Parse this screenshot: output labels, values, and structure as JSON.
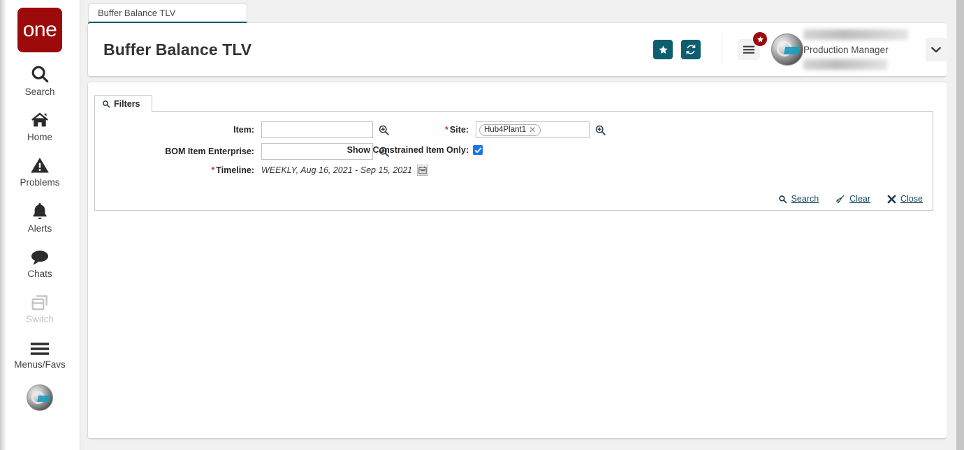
{
  "brand": {
    "logo_text": "one",
    "logo_color": "#9c0a0a",
    "accent_teal": "#0f5e70",
    "accent_blue": "#1a73e8",
    "link_color": "#1b4b66"
  },
  "sidebar": {
    "items": [
      {
        "label": "Search",
        "icon": "search-icon",
        "disabled": false
      },
      {
        "label": "Home",
        "icon": "home-icon",
        "disabled": false
      },
      {
        "label": "Problems",
        "icon": "warning-icon",
        "disabled": false
      },
      {
        "label": "Alerts",
        "icon": "bell-icon",
        "disabled": false
      },
      {
        "label": "Chats",
        "icon": "chat-icon",
        "disabled": false
      },
      {
        "label": "Switch",
        "icon": "switch-icon",
        "disabled": true
      },
      {
        "label": "Menus/Favs",
        "icon": "hamburger-icon",
        "disabled": false
      }
    ],
    "avatar": "user-avatar"
  },
  "tabs": [
    {
      "label": "Buffer Balance TLV",
      "active": true
    }
  ],
  "header": {
    "title": "Buffer Balance TLV",
    "favorite_icon": "star-icon",
    "refresh_icon": "refresh-icon",
    "menu_icon": "hamburger-icon",
    "menu_badge_icon": "star-badge-icon",
    "user_role": "Production Manager",
    "user_caret_icon": "chevron-down-icon"
  },
  "filters": {
    "tab_label": "Filters",
    "tab_icon": "search-icon",
    "fields": {
      "item": {
        "label": "Item:",
        "value": "",
        "placeholder": "",
        "required": false,
        "lookup_icon": "magnifier-plus-icon"
      },
      "bom_item_enterprise": {
        "label": "BOM Item Enterprise:",
        "value": "",
        "placeholder": "",
        "required": false,
        "lookup_icon": "magnifier-plus-icon"
      },
      "timeline": {
        "label": "Timeline:",
        "value": "WEEKLY, Aug 16, 2021 - Sep 15, 2021",
        "required": true,
        "calendar_icon": "calendar-icon"
      },
      "site": {
        "label": "Site:",
        "required": true,
        "chips": [
          {
            "label": "Hub4Plant1",
            "remove_icon": "close-x-icon"
          }
        ],
        "lookup_icon": "magnifier-plus-icon"
      },
      "show_constrained_item_only": {
        "label": "Show Constrained Item Only:",
        "checked": true,
        "checkbox_icon": "check-icon"
      }
    },
    "actions": [
      {
        "label": "Search",
        "icon": "search-icon"
      },
      {
        "label": "Clear",
        "icon": "broom-icon"
      },
      {
        "label": "Close",
        "icon": "close-x-icon"
      }
    ]
  }
}
